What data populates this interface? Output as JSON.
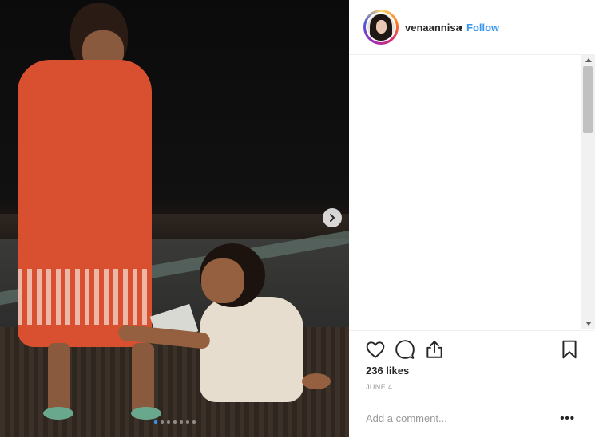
{
  "post": {
    "username": "venaannisa",
    "separator": "•",
    "follow_label": "Follow",
    "likes_text": "236 likes",
    "date_text": "JUNE 4",
    "comment_placeholder": "Add a comment...",
    "more_label": "•••"
  },
  "carousel": {
    "slide_count": 7,
    "active_index": 0
  },
  "colors": {
    "follow": "#3897f0",
    "text": "#262626",
    "muted": "#999999",
    "divider": "#efefef"
  },
  "icons": [
    "heart-icon",
    "comment-icon",
    "share-icon",
    "bookmark-icon",
    "chevron-right-icon",
    "more-options-icon"
  ]
}
